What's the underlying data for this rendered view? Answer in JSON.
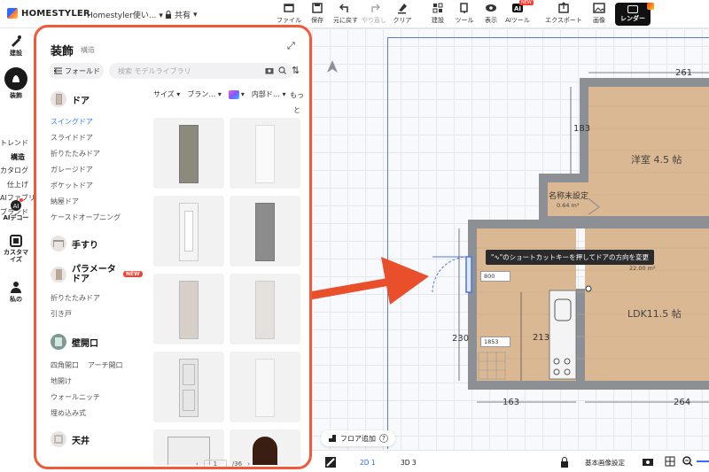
{
  "header": {
    "logo_text": "HOMESTYLER",
    "doc_title": "Homestyler使い...",
    "share_label": "共有",
    "toolbar": [
      {
        "label": "ファイル",
        "icon": "file-icon"
      },
      {
        "label": "保存",
        "icon": "save-icon"
      },
      {
        "label": "元に戻す",
        "icon": "undo-icon"
      },
      {
        "label": "やり直し",
        "icon": "redo-icon"
      },
      {
        "label": "クリア",
        "icon": "clear-icon"
      },
      {
        "label": "建設",
        "icon": "build-icon"
      },
      {
        "label": "ツール",
        "icon": "tool-icon"
      },
      {
        "label": "表示",
        "icon": "view-icon"
      },
      {
        "label": "AIツール",
        "icon": "ai-tool-icon"
      },
      {
        "label": "エクスポート",
        "icon": "export-icon"
      },
      {
        "label": "画像",
        "icon": "image-icon"
      }
    ],
    "ai_new_badge": "NEW",
    "render_label": "レンダー"
  },
  "rail": {
    "items": [
      {
        "label": "建設",
        "icon": "build-icon"
      },
      {
        "label": "装飾",
        "icon": "decor-icon"
      },
      {
        "label": "AIデコー",
        "icon": "ai-decor-icon"
      },
      {
        "label": "カスタマイズ",
        "icon": "customize-icon"
      },
      {
        "label": "私の",
        "icon": "my-icon"
      }
    ],
    "subnav": [
      "トレンド",
      "構造",
      "カタログ",
      "仕上げ",
      "AIファブリ",
      "ブランド"
    ]
  },
  "panel": {
    "title": "装飾",
    "subtitle": "構造",
    "fold_label": "フォールド",
    "search_placeholder": "検索 モデルライブラリ",
    "filters": [
      "サイズ",
      "ブラン…",
      "内部ド…"
    ],
    "more_label": "もっと",
    "categories": {
      "door": "ドア",
      "railing": "手すり",
      "parametric": "パラメータドア",
      "wall_opening": "壁開口",
      "ceiling": "天井"
    },
    "door_subs": [
      "スイングドア",
      "スライドドア",
      "折りたたみドア",
      "ガレージドア",
      "ポケットドア",
      "納屋ドア",
      "ケースドオープニング"
    ],
    "param_subs": [
      "折りたたみドア",
      "引き戸"
    ],
    "opening_subs": [
      "四角開口",
      "アーチ開口",
      "地開け",
      "ウォールニッチ",
      "埋め込み式"
    ],
    "new_badge": "NEW",
    "pager_current": "1",
    "pager_total": "/36"
  },
  "floorplan": {
    "dims": [
      "261",
      "183",
      "163",
      "264",
      "230",
      "213"
    ],
    "rooms": [
      {
        "name": "洋室 4.5 帖"
      },
      {
        "name": "名称未設定",
        "area": "0.64 m²"
      },
      {
        "name": "LDK11.5 帖",
        "area": "22.00 m²"
      }
    ],
    "tooltip": "\"∿\"のショートカットキーを押してドアの方向を変更",
    "inputs": [
      "800",
      "1853"
    ]
  },
  "bottom": {
    "floor_add": "フロア追加",
    "view_2d": "2D 1",
    "view_3d": "3D 3",
    "base_image": "基本画像設定"
  }
}
